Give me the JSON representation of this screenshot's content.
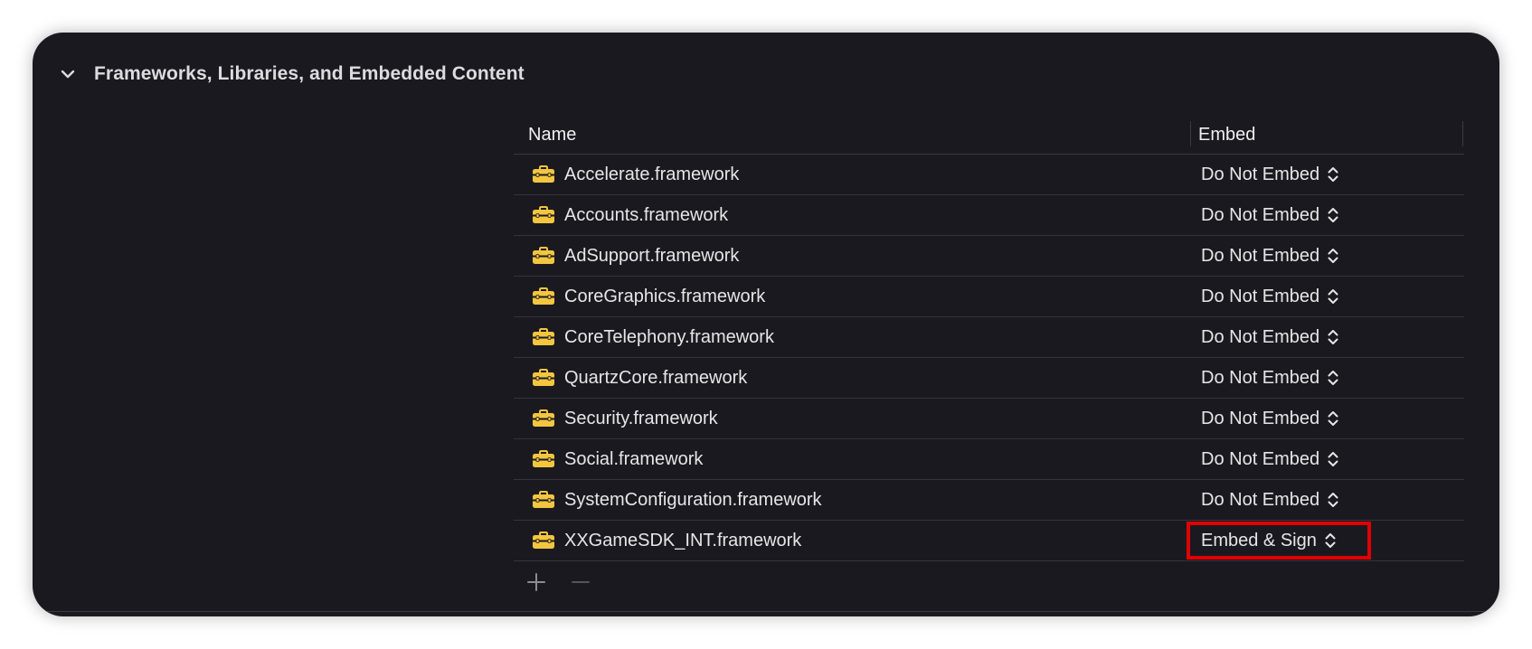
{
  "section": {
    "title": "Frameworks, Libraries, and Embedded Content",
    "expanded_icon": "chevron-down-icon"
  },
  "table": {
    "columns": {
      "name": "Name",
      "embed": "Embed"
    },
    "rows": [
      {
        "name": "Accelerate.framework",
        "embed": "Do Not Embed",
        "highlighted": false
      },
      {
        "name": "Accounts.framework",
        "embed": "Do Not Embed",
        "highlighted": false
      },
      {
        "name": "AdSupport.framework",
        "embed": "Do Not Embed",
        "highlighted": false
      },
      {
        "name": "CoreGraphics.framework",
        "embed": "Do Not Embed",
        "highlighted": false
      },
      {
        "name": "CoreTelephony.framework",
        "embed": "Do Not Embed",
        "highlighted": false
      },
      {
        "name": "QuartzCore.framework",
        "embed": "Do Not Embed",
        "highlighted": false
      },
      {
        "name": "Security.framework",
        "embed": "Do Not Embed",
        "highlighted": false
      },
      {
        "name": "Social.framework",
        "embed": "Do Not Embed",
        "highlighted": false
      },
      {
        "name": "SystemConfiguration.framework",
        "embed": "Do Not Embed",
        "highlighted": false
      },
      {
        "name": "XXGameSDK_INT.framework",
        "embed": "Embed & Sign",
        "highlighted": true
      }
    ],
    "row_icon": "framework-toolbox-icon",
    "select_icon": "up-down-chevron-icon"
  },
  "footer": {
    "add_icon": "plus-icon",
    "remove_icon": "minus-icon"
  },
  "colors": {
    "panel_bg": "#1b1920",
    "text": "#e6e6e8",
    "icon_yellow": "#f3c640",
    "highlight_box": "#e00000"
  }
}
